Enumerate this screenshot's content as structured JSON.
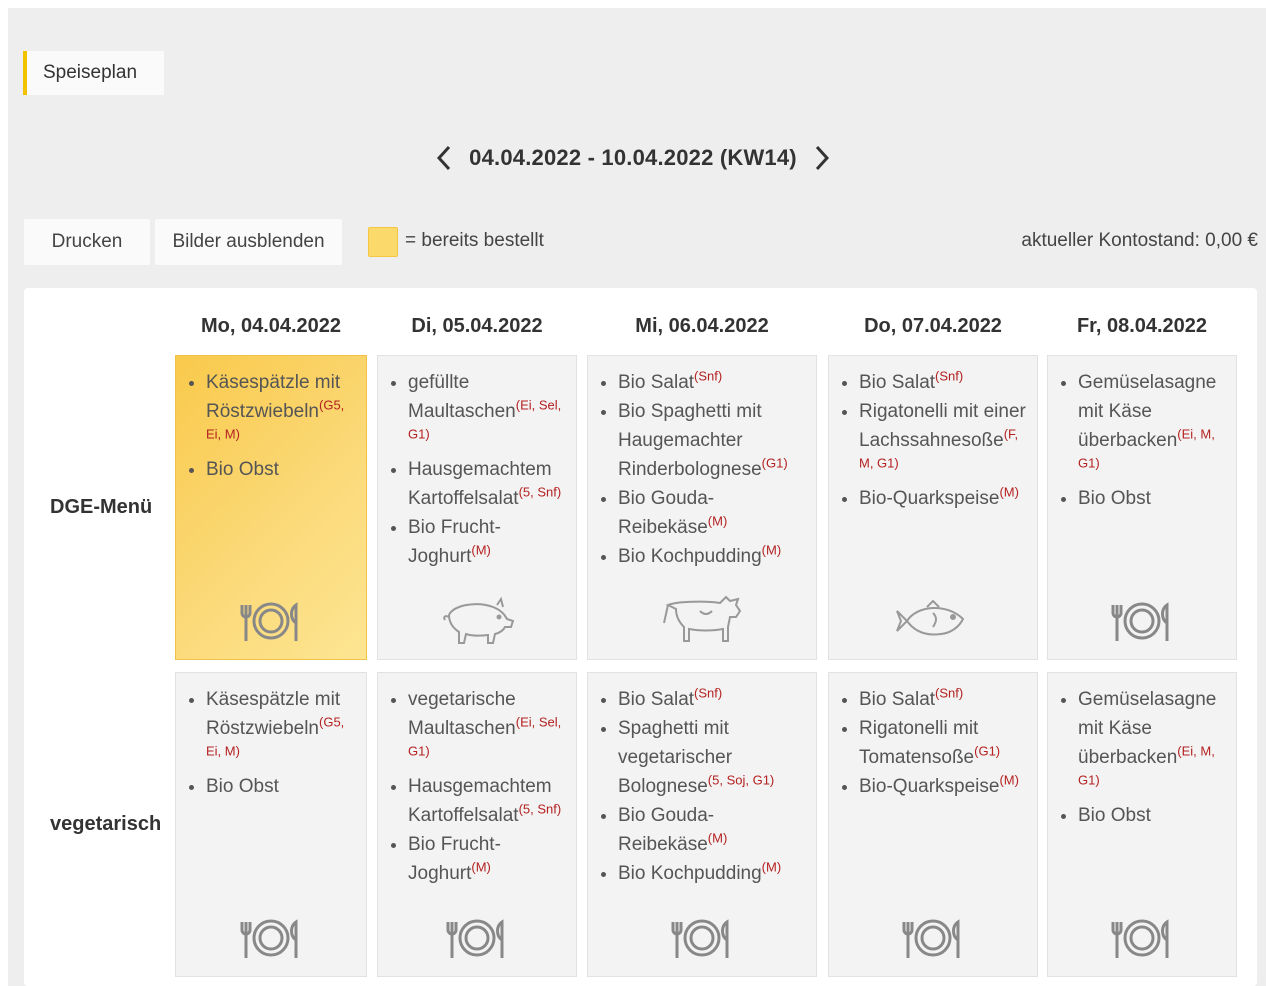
{
  "tab_label": "Speiseplan",
  "week": {
    "label": "04.04.2022 - 10.04.2022 (KW14)"
  },
  "toolbar": {
    "print_label": "Drucken",
    "hide_images_label": "Bilder ausblenden",
    "legend_label": "= bereits bestellt",
    "balance_label": "aktueller Kontostand: 0,00 €"
  },
  "days": [
    "Mo, 04.04.2022",
    "Di, 05.04.2022",
    "Mi, 06.04.2022",
    "Do, 07.04.2022",
    "Fr, 08.04.2022"
  ],
  "menus": [
    {
      "label": "DGE-Menü",
      "cells": [
        {
          "ordered": true,
          "icon": "plate-cutlery-icon",
          "items": [
            {
              "text": "Käsespätzle mit Röstzwiebeln",
              "allergens": "(G5, Ei, M)"
            },
            {
              "text": "Bio Obst",
              "allergens": ""
            }
          ]
        },
        {
          "ordered": false,
          "icon": "pig-icon",
          "items": [
            {
              "text": "gefüllte Maultaschen",
              "allergens": "(Ei, Sel, G1)"
            },
            {
              "text": "Hausgemachtem Kartoffelsalat",
              "allergens": "(5, Snf)"
            },
            {
              "text": "Bio Frucht-Joghurt",
              "allergens": "(M)"
            }
          ]
        },
        {
          "ordered": false,
          "icon": "cow-icon",
          "items": [
            {
              "text": "Bio Salat",
              "allergens": "(Snf)"
            },
            {
              "text": "Bio Spaghetti mit Haugemachter Rinderbolognese",
              "allergens": "(G1)"
            },
            {
              "text": "Bio Gouda-Reibekäse",
              "allergens": "(M)"
            },
            {
              "text": "Bio Kochpudding",
              "allergens": "(M)"
            }
          ]
        },
        {
          "ordered": false,
          "icon": "fish-icon",
          "items": [
            {
              "text": "Bio Salat",
              "allergens": "(Snf)"
            },
            {
              "text": "Rigatonelli mit einer Lachssahnesoße",
              "allergens": "(F, M, G1)"
            },
            {
              "text": "Bio-Quarkspeise",
              "allergens": "(M)"
            }
          ]
        },
        {
          "ordered": false,
          "icon": "plate-cutlery-icon",
          "items": [
            {
              "text": "Gemüselasagne mit Käse überbacken",
              "allergens": "(Ei, M, G1)"
            },
            {
              "text": "Bio Obst",
              "allergens": ""
            }
          ]
        }
      ]
    },
    {
      "label": "vegetarisch",
      "cells": [
        {
          "ordered": false,
          "icon": "plate-cutlery-icon",
          "items": [
            {
              "text": "Käsespätzle mit Röstzwiebeln",
              "allergens": "(G5, Ei, M)"
            },
            {
              "text": "Bio Obst",
              "allergens": ""
            }
          ]
        },
        {
          "ordered": false,
          "icon": "plate-cutlery-icon",
          "items": [
            {
              "text": "vegetarische Maultaschen",
              "allergens": "(Ei, Sel, G1)"
            },
            {
              "text": "Hausgemachtem Kartoffelsalat",
              "allergens": "(5, Snf)"
            },
            {
              "text": "Bio Frucht-Joghurt",
              "allergens": "(M)"
            }
          ]
        },
        {
          "ordered": false,
          "icon": "plate-cutlery-icon",
          "items": [
            {
              "text": "Bio Salat",
              "allergens": "(Snf)"
            },
            {
              "text": "Spaghetti mit vegetarischer Bolognese",
              "allergens": "(5, Soj, G1)"
            },
            {
              "text": "Bio Gouda-Reibekäse",
              "allergens": "(M)"
            },
            {
              "text": "Bio Kochpudding",
              "allergens": "(M)"
            }
          ]
        },
        {
          "ordered": false,
          "icon": "plate-cutlery-icon",
          "items": [
            {
              "text": "Bio Salat",
              "allergens": "(Snf)"
            },
            {
              "text": "Rigatonelli mit Tomatensoße",
              "allergens": "(G1)"
            },
            {
              "text": "Bio-Quarkspeise",
              "allergens": "(M)"
            }
          ]
        },
        {
          "ordered": false,
          "icon": "plate-cutlery-icon",
          "items": [
            {
              "text": "Gemüselasagne mit Käse überbacken",
              "allergens": "(Ei, M, G1)"
            },
            {
              "text": "Bio Obst",
              "allergens": ""
            }
          ]
        }
      ]
    }
  ]
}
